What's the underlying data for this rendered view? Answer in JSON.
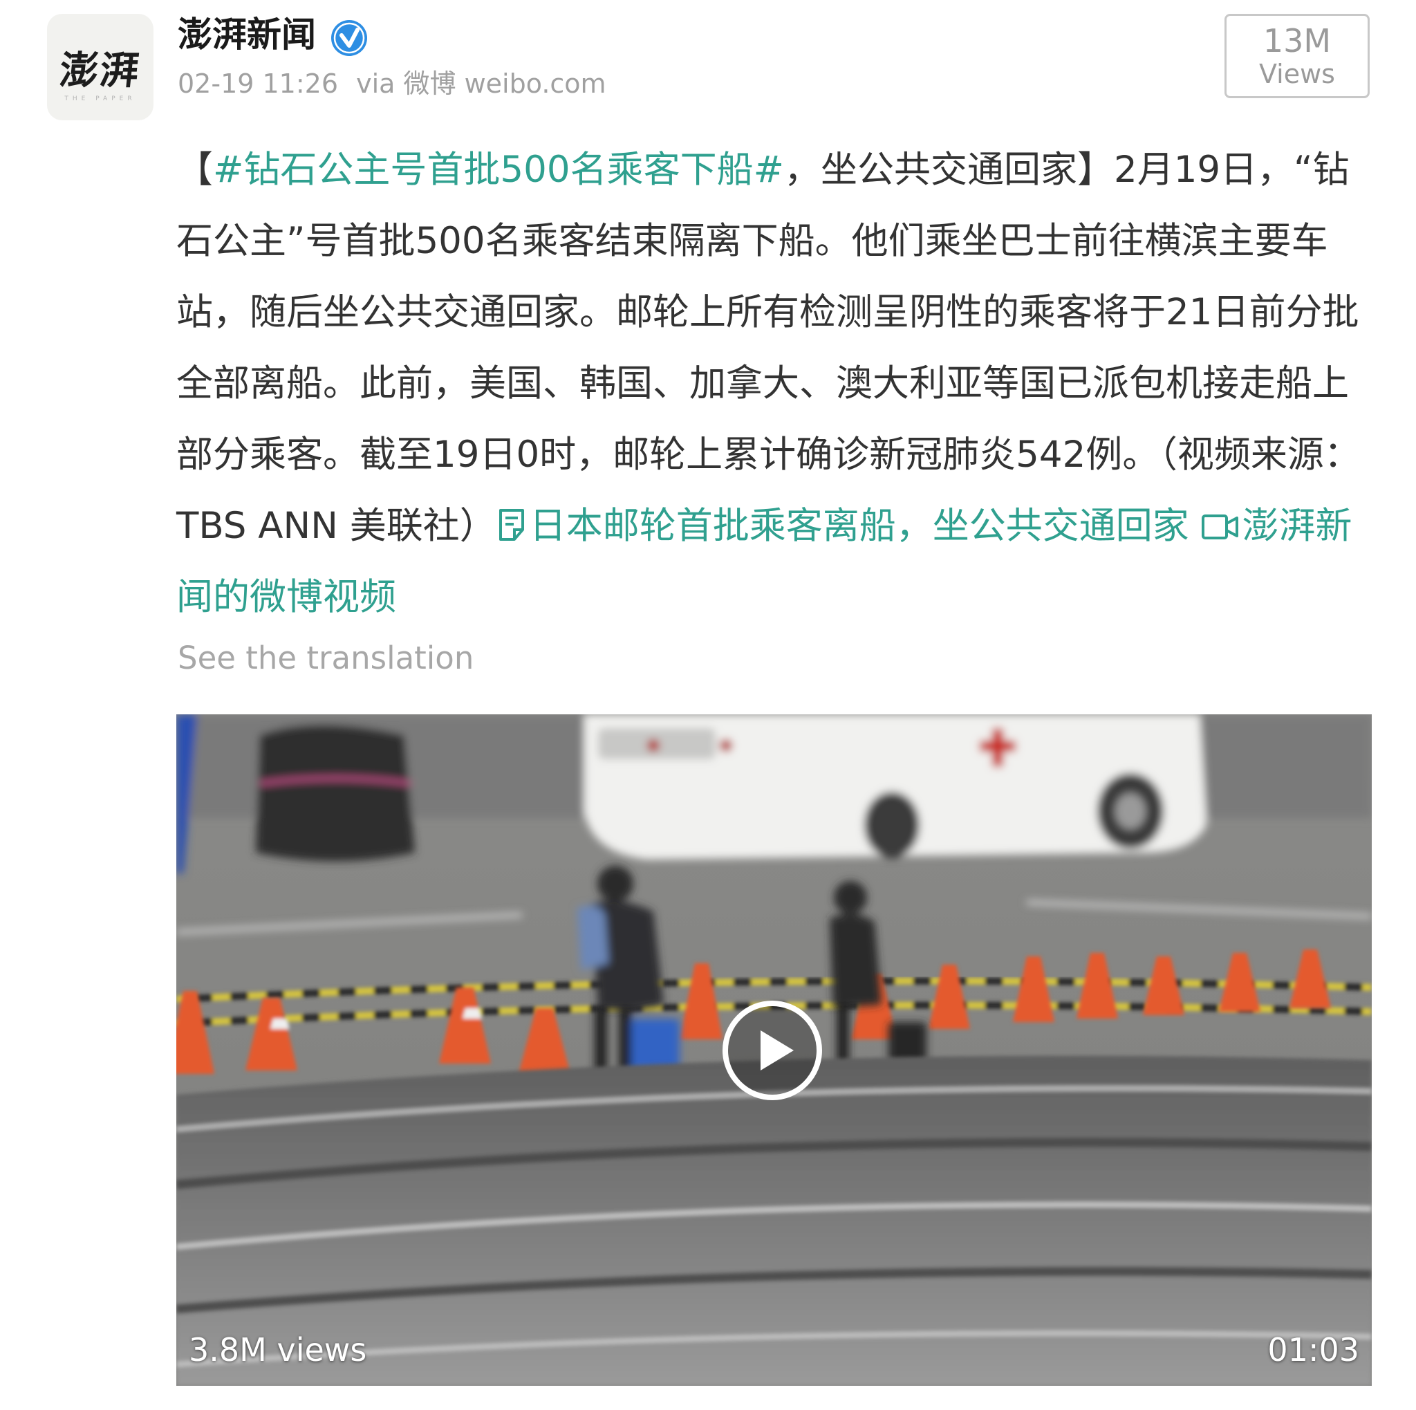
{
  "author": {
    "name": "澎湃新闻",
    "avatar_text": "澎湃",
    "avatar_subtext": "THE PAPER",
    "verified_icon": "verified-check-icon",
    "timestamp": "02-19 11:26",
    "source": "via 微博 weibo.com"
  },
  "views_box": {
    "count": "13M",
    "label": "Views"
  },
  "post": {
    "open_bracket": "【",
    "hashtag": "#钻石公主号首批500名乘客下船#",
    "body_1": "，坐公共交通回家】2月19日，“钻石公主”号首批500名乘客结束隔离下船。他们乘坐巴士前往横滨主要车站，随后坐公共交通回家。邮轮上所有检测呈阴性的乘客将于21日前分批全部离船。此前，美国、韩国、加拿大、澳大利亚等国已派包机接走船上部分乘客。截至19日0时，邮轮上累计确诊新冠肺炎542例。（视频来源：TBS ANN 美联社）",
    "article_link": "日本邮轮首批乘客离船，坐公共交通回家",
    "article_icon": "article-icon",
    "video_link": "澎湃新闻的微博视频",
    "video_icon": "video-icon"
  },
  "translate_label": "See the translation",
  "video": {
    "views": "3.8M views",
    "duration": "01:03",
    "play_icon": "play-icon"
  },
  "colors": {
    "link": "#2fa08f",
    "verified": "#2d8ee3",
    "meta_gray": "#a0a0a0"
  }
}
